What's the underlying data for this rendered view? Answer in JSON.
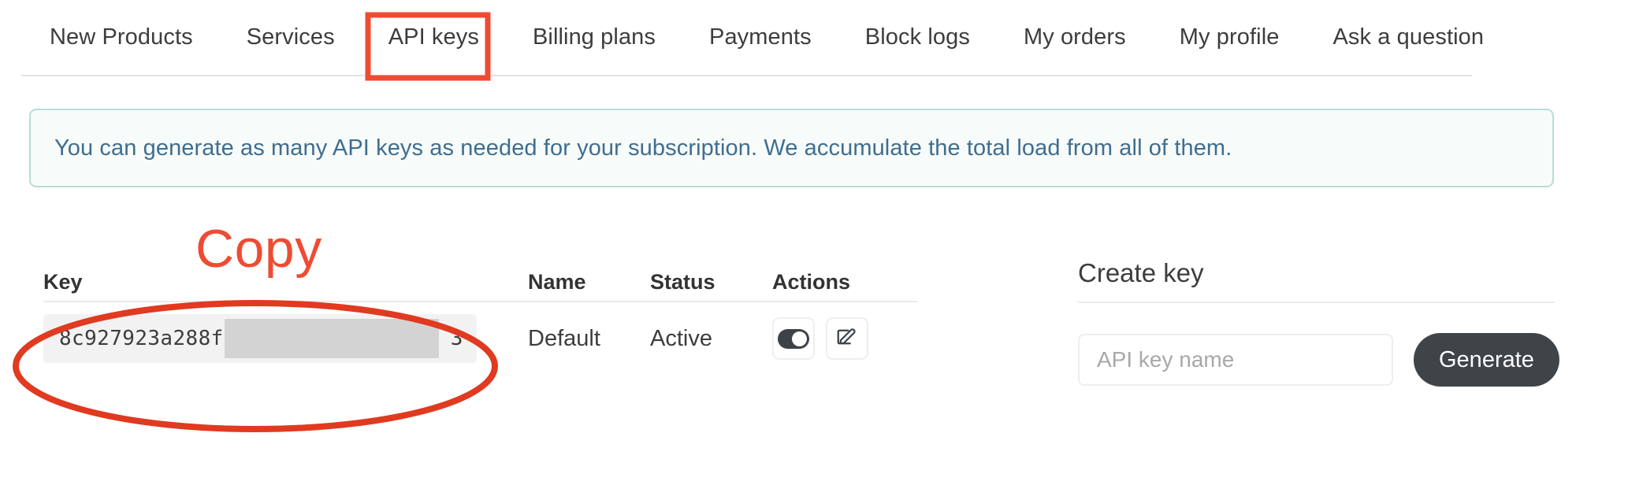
{
  "nav": {
    "items": [
      {
        "label": "New Products",
        "active": false
      },
      {
        "label": "Services",
        "active": false
      },
      {
        "label": "API keys",
        "active": true
      },
      {
        "label": "Billing plans",
        "active": false
      },
      {
        "label": "Payments",
        "active": false
      },
      {
        "label": "Block logs",
        "active": false
      },
      {
        "label": "My orders",
        "active": false
      },
      {
        "label": "My profile",
        "active": false
      },
      {
        "label": "Ask a question",
        "active": false
      }
    ]
  },
  "banner": {
    "text": "You can generate as many API keys as needed for your subscription. We accumulate the total load from all of them.",
    "text_color": "#3f6e8f",
    "border_color": "#b6ded6",
    "background_color": "#f7fbfa"
  },
  "table": {
    "headers": {
      "key": "Key",
      "name": "Name",
      "status": "Status",
      "actions": "Actions"
    },
    "rows": [
      {
        "key_visible": "8c927923a288f2",
        "key_suffix": "3",
        "key_redacted": true,
        "name": "Default",
        "status": "Active",
        "actions": {
          "toggle": "toggle-switch-on",
          "edit": "edit-pencil"
        }
      }
    ]
  },
  "create_key": {
    "title": "Create key",
    "input_placeholder": "API key name",
    "input_value": "",
    "button_label": "Generate",
    "button_color": "#3f4448"
  },
  "annotations": {
    "copy_label": "Copy",
    "color": "#ef4b33",
    "tab_highlight_box": "API keys",
    "ellipse_target": "api-key-value-cell"
  }
}
